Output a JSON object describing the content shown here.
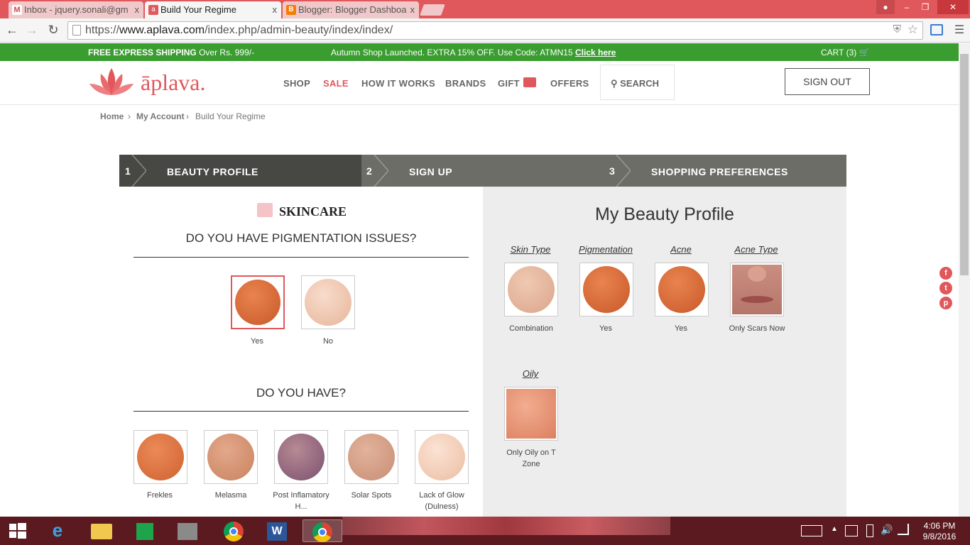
{
  "browser": {
    "tabs": [
      {
        "title": "Inbox - jquery.sonali@gm",
        "icon": "gmail-icon"
      },
      {
        "title": "Build Your Regime",
        "icon": "aplava-icon"
      },
      {
        "title": "Blogger: Blogger Dashboa",
        "icon": "blogger-icon"
      }
    ],
    "close_glyph": "x",
    "url_prefix": "https://",
    "url_host": "www.aplava.com",
    "url_path": "/index.php/admin-beauty/index/index/"
  },
  "promo": {
    "left_bold": "FREE EXPRESS SHIPPING",
    "left_rest": "Over Rs. 999/-",
    "center": "Autumn Shop Launched. EXTRA 15% OFF. Use Code: ATMN15",
    "center_link": "Click here",
    "cart": "CART (3)"
  },
  "header": {
    "logo_text": "āplava.",
    "nav": [
      "SHOP",
      "SALE",
      "HOW IT WORKS",
      "BRANDS",
      "GIFT",
      "OFFERS"
    ],
    "search": "SEARCH",
    "signout": "SIGN OUT"
  },
  "breadcrumb": {
    "home": "Home",
    "account": "My Account",
    "current": "Build Your Regime",
    "sep": "›"
  },
  "steps": [
    {
      "num": "1",
      "label": "BEAUTY PROFILE"
    },
    {
      "num": "2",
      "label": "SIGN UP"
    },
    {
      "num": "3",
      "label": "SHOPPING PREFERENCES"
    }
  ],
  "left": {
    "section_title": "SKINCARE",
    "q1": "DO YOU HAVE PIGMENTATION ISSUES?",
    "q1_options": [
      "Yes",
      "No"
    ],
    "q2": "DO YOU HAVE?",
    "q2_options": [
      "Frekles",
      "Melasma",
      "Post Inflamatory H...",
      "Solar Spots",
      "Lack of Glow (Dulness)"
    ]
  },
  "right": {
    "title": "My Beauty Profile",
    "items": [
      {
        "label": "Skin Type",
        "value": "Combination"
      },
      {
        "label": "Pigmentation",
        "value": "Yes"
      },
      {
        "label": "Acne",
        "value": "Yes"
      },
      {
        "label": "Acne Type",
        "value": "Only Scars Now"
      },
      {
        "label": "Oily",
        "value": "Only Oily on T Zone"
      }
    ]
  },
  "social": [
    "f",
    "t",
    "p"
  ],
  "colors": {
    "brand": "#e0585c",
    "green": "#3a9d2f",
    "step_active": "#474743",
    "step": "#6d6d68"
  },
  "taskbar": {
    "time": "4:06 PM",
    "date": "9/8/2016"
  }
}
